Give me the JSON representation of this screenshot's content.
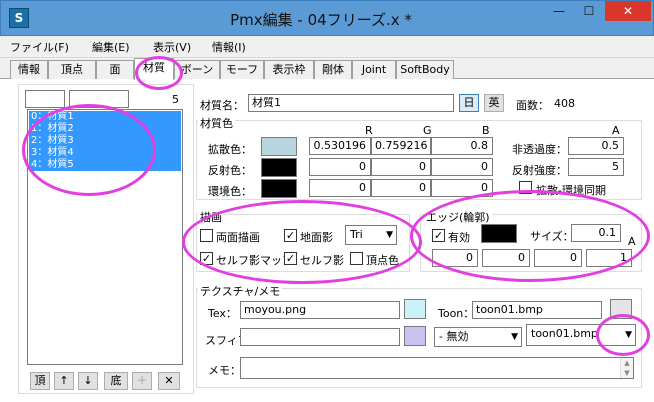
{
  "window": {
    "title": "Pmx編集 - 04フリーズ.x *",
    "app_icon": "S",
    "minimize": "—",
    "maximize": "☐",
    "close": "✕"
  },
  "menu": [
    "ファイル(F)",
    "編集(E)",
    "表示(V)",
    "情報(I)"
  ],
  "tabs": [
    "情報",
    "頂点",
    "面",
    "材質",
    "ボーン",
    "モーフ",
    "表示枠",
    "剛体",
    "Joint",
    "SoftBody"
  ],
  "left": {
    "search_a": "",
    "search_b": "",
    "count": "5",
    "items": [
      "0：材質1",
      "1：材質2",
      "2：材質3",
      "3：材質4",
      "4：材質5"
    ],
    "buttons": {
      "top": "頂",
      "up": "↑",
      "down": "↓",
      "bottom": "底",
      "add": "＋",
      "delete": "✕"
    }
  },
  "material": {
    "name_label": "材質名：",
    "name_value": "材質1",
    "lang_ja": "日",
    "lang_en": "英",
    "face_count_label": "面数：",
    "face_count": "408",
    "color_group_label": "材質色",
    "rgb_headers": {
      "r": "R",
      "g": "G",
      "b": "B",
      "a": "A"
    },
    "diffuse_label": "拡散色：",
    "diffuse": [
      "0.530196",
      "0.759216",
      "0.8"
    ],
    "diffuse_color": "#b8d4dc",
    "specular_label": "反射色：",
    "specular": [
      "0",
      "0",
      "0"
    ],
    "specular_color": "#000000",
    "ambient_label": "環境色：",
    "ambient": [
      "0",
      "0",
      "0"
    ],
    "ambient_color": "#000000",
    "opacity_label": "非透過度：",
    "opacity": "0.5",
    "reflect_label": "反射強度：",
    "reflect": "5",
    "sync_label": "拡散-環境同期"
  },
  "draw": {
    "group_label": "描画",
    "double_sided": "両面描画",
    "ground_shadow": "地面影",
    "shadow_mode": "Tri",
    "self_shadow_map": "セルフ影マップ",
    "self_shadow": "セルフ影",
    "vertex_color": "頂点色"
  },
  "edge": {
    "group_label": "エッジ(輪郭)",
    "enabled": "有効",
    "color": "#000000",
    "size_label": "サイズ：",
    "size": "0.1",
    "a_label": "A",
    "rgba": [
      "0",
      "0",
      "0",
      "1"
    ]
  },
  "texture": {
    "group_label": "テクスチャ/メモ",
    "tex_label": "Tex：",
    "tex_value": "moyou.png",
    "tex_color": "#c8f4f8",
    "toon_label": "Toon：",
    "toon_value": "toon01.bmp",
    "sphere_label": "スフィア：",
    "sphere_value": "",
    "sphere_color": "#c8c4f0",
    "sphere_mode": "- 無効",
    "toon_select": "toon01.bmp",
    "memo_label": "メモ：",
    "memo_value": ""
  }
}
